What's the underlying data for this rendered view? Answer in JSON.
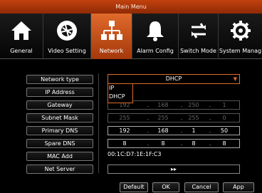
{
  "window": {
    "title": "Main Menu"
  },
  "toolbar": {
    "items": [
      {
        "label": "General",
        "icon": "home-icon"
      },
      {
        "label": "Video Setting",
        "icon": "camera-aperture-icon"
      },
      {
        "label": "Network",
        "icon": "network-tree-icon",
        "active": true
      },
      {
        "label": "Alarm Config",
        "icon": "bell-icon"
      },
      {
        "label": "Switch Mode",
        "icon": "swap-arrows-icon"
      },
      {
        "label": "System Manag",
        "icon": "gear-icon"
      }
    ]
  },
  "form": {
    "network_type": {
      "label": "Network type",
      "value": "DHCP",
      "options": [
        "IP",
        "DHCP"
      ]
    },
    "ip_address": {
      "label": "IP Address"
    },
    "gateway": {
      "label": "Gateway",
      "octets": [
        "192",
        "168",
        "250",
        "1"
      ]
    },
    "subnet_mask": {
      "label": "Subnet Mask",
      "octets": [
        "255",
        "255",
        "255",
        "0"
      ]
    },
    "primary_dns": {
      "label": "Primary DNS",
      "octets": [
        "192",
        "168",
        "1",
        "50"
      ]
    },
    "spare_dns": {
      "label": "Spare DNS",
      "octets": [
        "8",
        "8",
        "8",
        "8"
      ]
    },
    "mac_add": {
      "label": "MAC Add",
      "value": "00:1C:D7:1E:1F:C3"
    },
    "net_server": {
      "label": "Net Server",
      "button": "▸▸"
    }
  },
  "buttons": {
    "default": "Default",
    "ok": "OK",
    "cancel": "Cancel",
    "apply": "App"
  },
  "colors": {
    "accent": "#e06a2b",
    "title_bar": "#b23a0c"
  }
}
